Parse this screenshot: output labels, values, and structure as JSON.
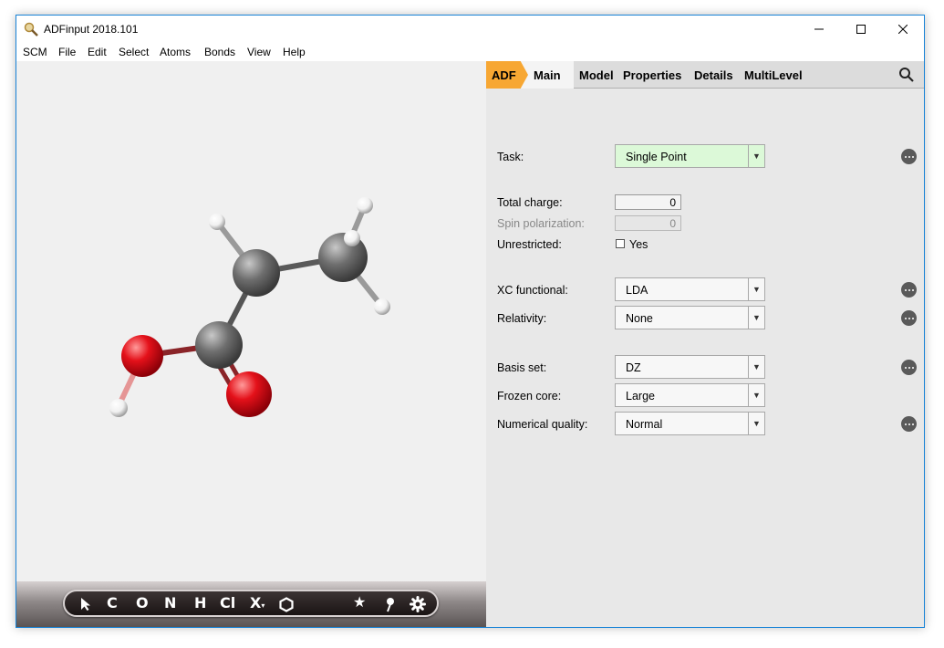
{
  "window": {
    "title": "ADFinput 2018.101"
  },
  "menu": [
    "SCM",
    "File",
    "Edit",
    "Select",
    "Atoms",
    "Bonds",
    "View",
    "Help"
  ],
  "toolbar": {
    "tools": [
      "C",
      "O",
      "N",
      "H",
      "Cl",
      "X"
    ],
    "icons": [
      "select-arrow-icon",
      "ring-icon",
      "star-icon",
      "pin-icon",
      "gear-icon"
    ]
  },
  "tabs": {
    "adf": "ADF",
    "main": "Main",
    "others": [
      "Model",
      "Properties",
      "Details",
      "MultiLevel"
    ]
  },
  "form": {
    "task": {
      "label": "Task:",
      "value": "Single Point"
    },
    "total_charge": {
      "label": "Total charge:",
      "value": "0"
    },
    "spin_polarization": {
      "label": "Spin polarization:",
      "value": "0"
    },
    "unrestricted": {
      "label": "Unrestricted:",
      "option": "Yes"
    },
    "xc_functional": {
      "label": "XC functional:",
      "value": "LDA"
    },
    "relativity": {
      "label": "Relativity:",
      "value": "None"
    },
    "basis_set": {
      "label": "Basis set:",
      "value": "DZ"
    },
    "frozen_core": {
      "label": "Frozen core:",
      "value": "Large"
    },
    "numerical_quality": {
      "label": "Numerical quality:",
      "value": "Normal"
    }
  },
  "colors": {
    "accent": "#f7a733",
    "task_bg": "#dcf9d8",
    "oxygen": "#e0101a",
    "carbon": "#4a4a4a",
    "hydrogen": "#ffffff"
  }
}
